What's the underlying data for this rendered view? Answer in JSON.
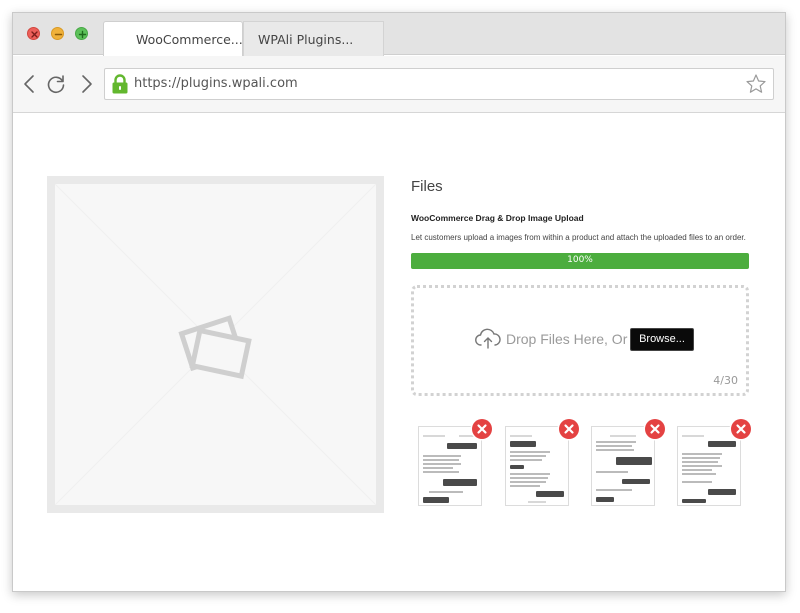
{
  "window": {
    "traffic_lights": {
      "close": "close-icon",
      "minimize": "minimize-icon",
      "maximize": "maximize-icon"
    }
  },
  "tabs": [
    {
      "label": "WooCommerce..."
    },
    {
      "label": "WPAli Plugins..."
    }
  ],
  "toolbar": {
    "back_icon": "arrow-left-icon",
    "reload_icon": "reload-icon",
    "forward_icon": "arrow-right-icon",
    "url": "https://plugins.wpali.com",
    "lock_icon": "lock-icon",
    "lock_color": "#62b72e",
    "bookmark_icon": "star-icon"
  },
  "product": {
    "image_placeholder_icon": "image-placeholder-icon",
    "files_heading": "Files",
    "title": "WooCommerce Drag & Drop Image Upload",
    "description": "Let customers upload a images from within a product and attach the uploaded files to an order."
  },
  "upload": {
    "progress_percent": 100,
    "progress_label": "100%",
    "progress_color": "#4cad3e",
    "drop_text": "Drop Files Here, Or",
    "browse_label": "Browse...",
    "counter": "4/30",
    "thumbnails": [
      {
        "remove_icon": "close-icon"
      },
      {
        "remove_icon": "close-icon"
      },
      {
        "remove_icon": "close-icon"
      },
      {
        "remove_icon": "close-icon"
      }
    ],
    "remove_color": "#e44242"
  }
}
